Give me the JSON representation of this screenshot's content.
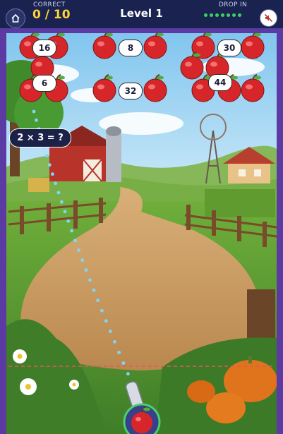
{
  "hud": {
    "correct_label": "CORRECT",
    "score": "0 / 10",
    "level": "Level 1",
    "drop_label": "DROP IN",
    "drop_dots": 7,
    "home_icon": "home-icon",
    "mute_icon": "mute-icon"
  },
  "question": "2 × 3 = ?",
  "apples": {
    "labels": [
      "16",
      "8",
      "30",
      "6",
      "32",
      "44"
    ]
  },
  "colors": {
    "frame": "#5b3aa3",
    "hud_bg": "#1a2350",
    "score": "#ffd23a",
    "apple": "#d7262a",
    "aim_dots": "#7fd6f6",
    "drop_line": "#e05a5a"
  }
}
